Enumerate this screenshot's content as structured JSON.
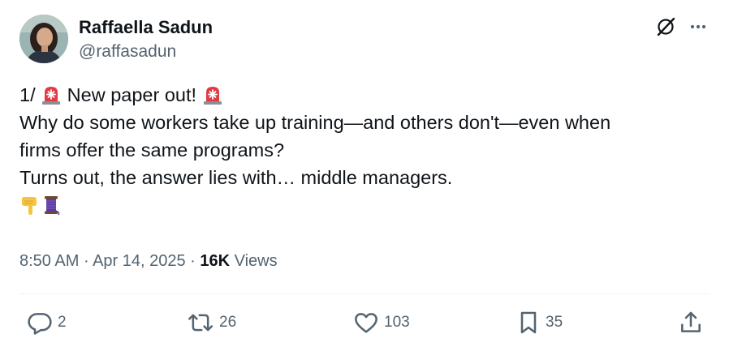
{
  "author": {
    "name": "Raffaella Sadun",
    "handle": "@raffasadun"
  },
  "header_icons": [
    "grok-icon",
    "more-icon"
  ],
  "tweet": {
    "lines": [
      {
        "prefix": "1/ ",
        "middle": " New paper out! ",
        "emojis": [
          "siren-emoji",
          "siren-emoji"
        ]
      },
      {
        "text": "Why do some workers take up training—and others don't—even when"
      },
      {
        "text": "firms offer the same programs?"
      },
      {
        "text": "Turns out, the answer lies with… middle managers."
      },
      {
        "emojis": [
          "point-down-emoji",
          "thread-emoji"
        ]
      }
    ]
  },
  "meta": {
    "time": "8:50 AM",
    "separator": " · ",
    "date": "Apr 14, 2025",
    "views_count": "16K",
    "views_label": " Views"
  },
  "actions": {
    "replies": "2",
    "retweets": "26",
    "likes": "103",
    "bookmarks": "35"
  },
  "colors": {
    "text": "#0f1419",
    "secondary": "#536471",
    "divider": "#eff3f4"
  }
}
